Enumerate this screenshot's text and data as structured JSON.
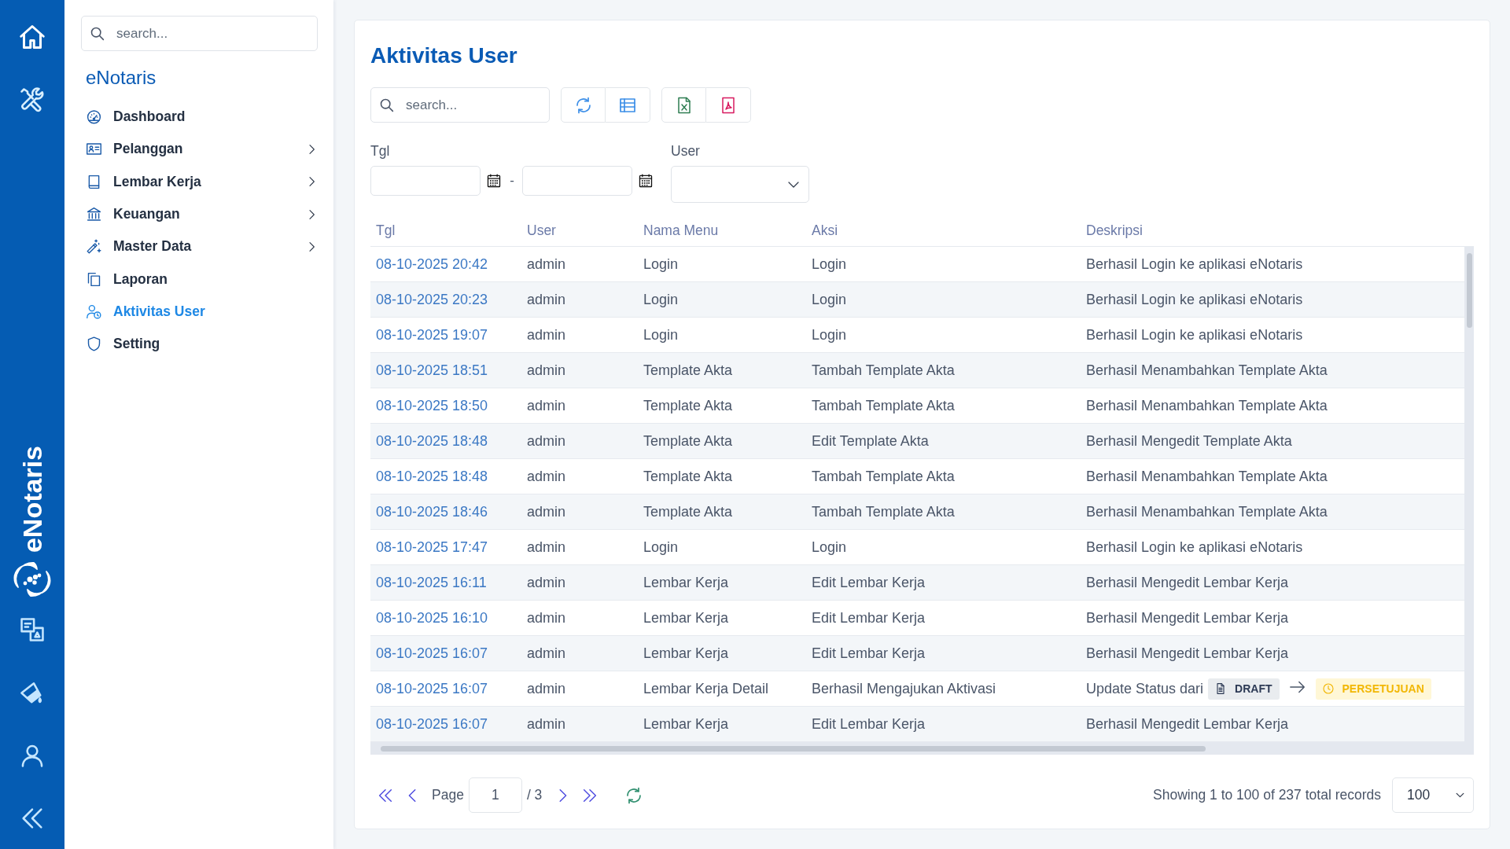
{
  "rail": {
    "brand": "eNotaris"
  },
  "sidebar": {
    "search": {
      "placeholder": "search..."
    },
    "title": "eNotaris",
    "items": [
      {
        "label": "Dashboard",
        "selected": false,
        "expandable": false
      },
      {
        "label": "Pelanggan",
        "selected": false,
        "expandable": true
      },
      {
        "label": "Lembar Kerja",
        "selected": false,
        "expandable": true
      },
      {
        "label": "Keuangan",
        "selected": false,
        "expandable": true
      },
      {
        "label": "Master Data",
        "selected": false,
        "expandable": true
      },
      {
        "label": "Laporan",
        "selected": false,
        "expandable": false
      },
      {
        "label": "Aktivitas User",
        "selected": true,
        "expandable": false
      },
      {
        "label": "Setting",
        "selected": false,
        "expandable": false
      }
    ]
  },
  "page": {
    "title": "Aktivitas User",
    "search": {
      "placeholder": "search..."
    },
    "filters": {
      "date_label": "Tgl",
      "date_separator": "-",
      "user_label": "User"
    }
  },
  "table": {
    "columns": [
      "Tgl",
      "User",
      "Nama Menu",
      "Aksi",
      "Deskripsi"
    ],
    "rows": [
      {
        "cells": [
          "08-10-2025 20:42",
          "admin",
          "Login",
          "Login"
        ],
        "description": {
          "kind": "text",
          "text": "Berhasil Login ke aplikasi eNotaris"
        }
      },
      {
        "cells": [
          "08-10-2025 20:23",
          "admin",
          "Login",
          "Login"
        ],
        "description": {
          "kind": "text",
          "text": "Berhasil Login ke aplikasi eNotaris"
        }
      },
      {
        "cells": [
          "08-10-2025 19:07",
          "admin",
          "Login",
          "Login"
        ],
        "description": {
          "kind": "text",
          "text": "Berhasil Login ke aplikasi eNotaris"
        }
      },
      {
        "cells": [
          "08-10-2025 18:51",
          "admin",
          "Template Akta",
          "Tambah Template Akta"
        ],
        "description": {
          "kind": "text",
          "text": "Berhasil Menambahkan Template Akta"
        }
      },
      {
        "cells": [
          "08-10-2025 18:50",
          "admin",
          "Template Akta",
          "Tambah Template Akta"
        ],
        "description": {
          "kind": "text",
          "text": "Berhasil Menambahkan Template Akta"
        }
      },
      {
        "cells": [
          "08-10-2025 18:48",
          "admin",
          "Template Akta",
          "Edit Template Akta"
        ],
        "description": {
          "kind": "text",
          "text": "Berhasil Mengedit Template Akta"
        }
      },
      {
        "cells": [
          "08-10-2025 18:48",
          "admin",
          "Template Akta",
          "Tambah Template Akta"
        ],
        "description": {
          "kind": "text",
          "text": "Berhasil Menambahkan Template Akta"
        }
      },
      {
        "cells": [
          "08-10-2025 18:46",
          "admin",
          "Template Akta",
          "Tambah Template Akta"
        ],
        "description": {
          "kind": "text",
          "text": "Berhasil Menambahkan Template Akta"
        }
      },
      {
        "cells": [
          "08-10-2025 17:47",
          "admin",
          "Login",
          "Login"
        ],
        "description": {
          "kind": "text",
          "text": "Berhasil Login ke aplikasi eNotaris"
        }
      },
      {
        "cells": [
          "08-10-2025 16:11",
          "admin",
          "Lembar Kerja",
          "Edit Lembar Kerja"
        ],
        "description": {
          "kind": "text",
          "text": "Berhasil Mengedit Lembar Kerja"
        }
      },
      {
        "cells": [
          "08-10-2025 16:10",
          "admin",
          "Lembar Kerja",
          "Edit Lembar Kerja"
        ],
        "description": {
          "kind": "text",
          "text": "Berhasil Mengedit Lembar Kerja"
        }
      },
      {
        "cells": [
          "08-10-2025 16:07",
          "admin",
          "Lembar Kerja",
          "Edit Lembar Kerja"
        ],
        "description": {
          "kind": "text",
          "text": "Berhasil Mengedit Lembar Kerja"
        }
      },
      {
        "cells": [
          "08-10-2025 16:07",
          "admin",
          "Lembar Kerja Detail",
          "Berhasil Mengajukan Aktivasi"
        ],
        "description": {
          "kind": "status_change",
          "text": "Update Status dari",
          "badges": [
            {
              "label": "DRAFT",
              "kind": "draft"
            },
            {
              "label": "PERSETUJUAN",
              "kind": "pending"
            }
          ]
        }
      },
      {
        "cells": [
          "08-10-2025 16:07",
          "admin",
          "Lembar Kerja",
          "Edit Lembar Kerja"
        ],
        "description": {
          "kind": "text",
          "text": "Berhasil Mengedit Lembar Kerja"
        }
      }
    ]
  },
  "pagination": {
    "page_label": "Page",
    "page": "1",
    "total_pages": "/ 3",
    "summary": "Showing 1 to 100 of 237 total records",
    "page_size": "100"
  }
}
